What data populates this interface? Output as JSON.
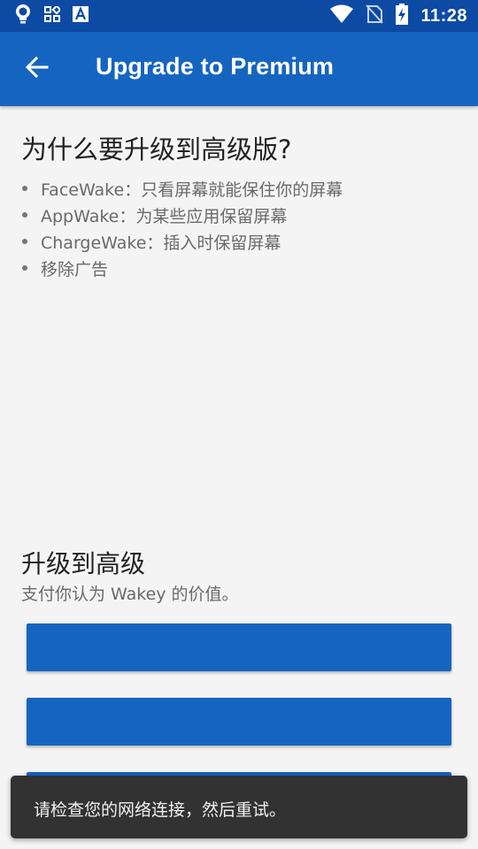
{
  "status_bar": {
    "time": "11:28",
    "icons": [
      "lightbulb-icon",
      "apps-icon",
      "font-icon",
      "wifi-icon",
      "no-sim-icon",
      "battery-charging-icon"
    ]
  },
  "app_bar": {
    "title": "Upgrade to Premium",
    "back_icon": "arrow-back-icon"
  },
  "why": {
    "heading": "为什么要升级到高级版?",
    "features": [
      "FaceWake：只看屏幕就能保住你的屏幕",
      "AppWake：为某些应用保留屏幕",
      "ChargeWake：插入时保留屏幕",
      "移除广告"
    ]
  },
  "upgrade": {
    "heading": "升级到高级",
    "subtitle": "支付你认为 Wakey 的价值。",
    "buttons": [
      "",
      "",
      ""
    ]
  },
  "toast": {
    "message": "请检查您的网络连接，然后重试。"
  },
  "colors": {
    "status_bar": "#0d4aa3",
    "app_bar": "#1565c0",
    "background": "#f4f4f4",
    "toast": "#323232"
  }
}
